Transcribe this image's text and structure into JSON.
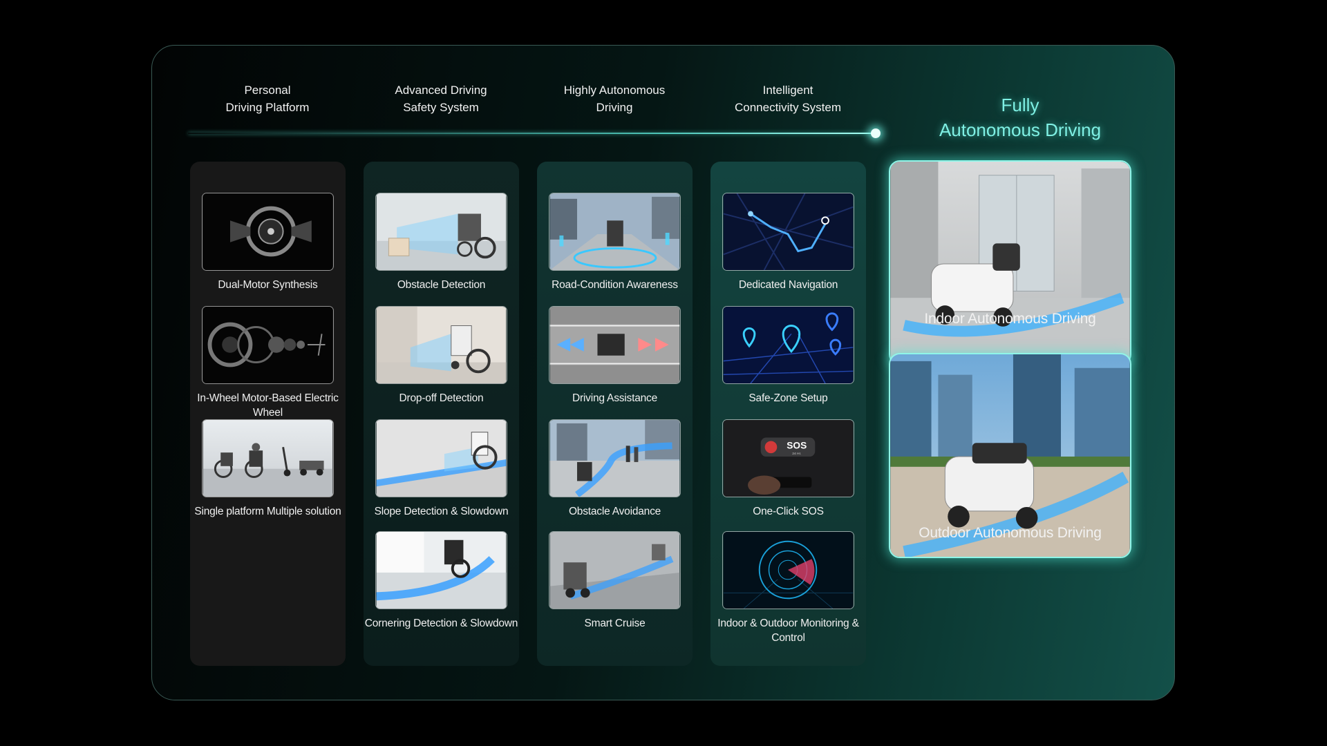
{
  "stages": [
    {
      "line1": "Personal",
      "line2": "Driving Platform"
    },
    {
      "line1": "Advanced Driving",
      "line2": "Safety System"
    },
    {
      "line1": "Highly Autonomous",
      "line2": "Driving"
    },
    {
      "line1": "Intelligent",
      "line2": "Connectivity System"
    }
  ],
  "final_stage": {
    "line1": "Fully",
    "line2": "Autonomous Driving"
  },
  "columns": [
    {
      "features": [
        {
          "label": "Dual-Motor Synthesis",
          "icon": "dual-motor-image"
        },
        {
          "label": "In-Wheel Motor-Based Electric Wheel",
          "icon": "electric-wheel-image"
        },
        {
          "label": "Single platform Multiple solution",
          "icon": "platform-lineup-image"
        }
      ]
    },
    {
      "features": [
        {
          "label": "Obstacle Detection",
          "icon": "obstacle-detection-image"
        },
        {
          "label": "Drop-off Detection",
          "icon": "drop-off-detection-image"
        },
        {
          "label": "Slope Detection & Slowdown",
          "icon": "slope-detection-image"
        },
        {
          "label": "Cornering Detection & Slowdown",
          "icon": "cornering-detection-image"
        }
      ]
    },
    {
      "features": [
        {
          "label": "Road-Condition Awareness",
          "icon": "road-condition-image"
        },
        {
          "label": "Driving Assistance",
          "icon": "driving-assistance-image"
        },
        {
          "label": "Obstacle Avoidance",
          "icon": "obstacle-avoidance-image"
        },
        {
          "label": "Smart Cruise",
          "icon": "smart-cruise-image"
        }
      ]
    },
    {
      "features": [
        {
          "label": "Dedicated Navigation",
          "icon": "navigation-map-image"
        },
        {
          "label": "Safe-Zone Setup",
          "icon": "safe-zone-pins-image"
        },
        {
          "label": "One-Click SOS",
          "icon": "sos-phone-image"
        },
        {
          "label": "Indoor & Outdoor Monitoring & Control",
          "icon": "radar-monitoring-image"
        }
      ]
    }
  ],
  "final_cards": [
    {
      "label": "Indoor Autonomous Driving",
      "icon": "indoor-driving-image"
    },
    {
      "label": "Outdoor Autonomous Driving",
      "icon": "outdoor-driving-image"
    }
  ],
  "sos_badge": {
    "text": "SOS",
    "subtext": "24 Hr."
  },
  "colors": {
    "accent": "#7ff0e4",
    "timeline": "#4fc8bb",
    "path": "#3aa0ff"
  }
}
